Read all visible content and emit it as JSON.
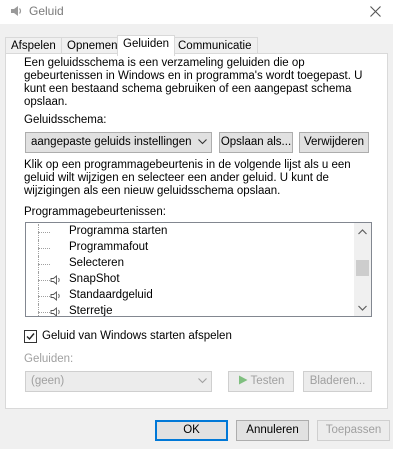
{
  "window": {
    "title": "Geluid",
    "icon": "speaker-app-icon"
  },
  "tabs": [
    {
      "label": "Afspelen"
    },
    {
      "label": "Opnemen"
    },
    {
      "label": "Geluiden"
    },
    {
      "label": "Communicatie"
    }
  ],
  "intro_text": "Een geluidsschema is een verzameling geluiden die op gebeurtenissen in Windows en in programma's wordt toegepast.  U kunt een bestaand schema gebruiken of een aangepast schema opslaan.",
  "scheme": {
    "label": "Geluidsschema:",
    "selected": "aangepaste geluids instellingen",
    "save_label": "Opslaan als...",
    "delete_label": "Verwijderen"
  },
  "events_text": "Klik op een programmagebeurtenis in de volgende lijst als u een geluid wilt wijzigen en selecteer een ander geluid. U kunt de wijzigingen als een nieuw geluidsschema opslaan.",
  "events": {
    "label": "Programmagebeurtenissen:",
    "items": [
      {
        "label": "Programma starten",
        "has_sound": false
      },
      {
        "label": "Programmafout",
        "has_sound": false
      },
      {
        "label": "Selecteren",
        "has_sound": false
      },
      {
        "label": "SnapShot",
        "has_sound": true
      },
      {
        "label": "Standaardgeluid",
        "has_sound": true
      },
      {
        "label": "Sterretje",
        "has_sound": true
      }
    ]
  },
  "startup": {
    "label": "Geluid van Windows starten afspelen",
    "checked": true
  },
  "sounds": {
    "label": "Geluiden:",
    "selected": "(geen)",
    "test_label": "Testen",
    "browse_label": "Bladeren..."
  },
  "footer": {
    "ok_label": "OK",
    "cancel_label": "Annuleren",
    "apply_label": "Toepassen"
  },
  "colors": {
    "accent": "#0078d7",
    "disabled_text": "#a0a0a0",
    "test_icon": "#7fbf7f"
  }
}
